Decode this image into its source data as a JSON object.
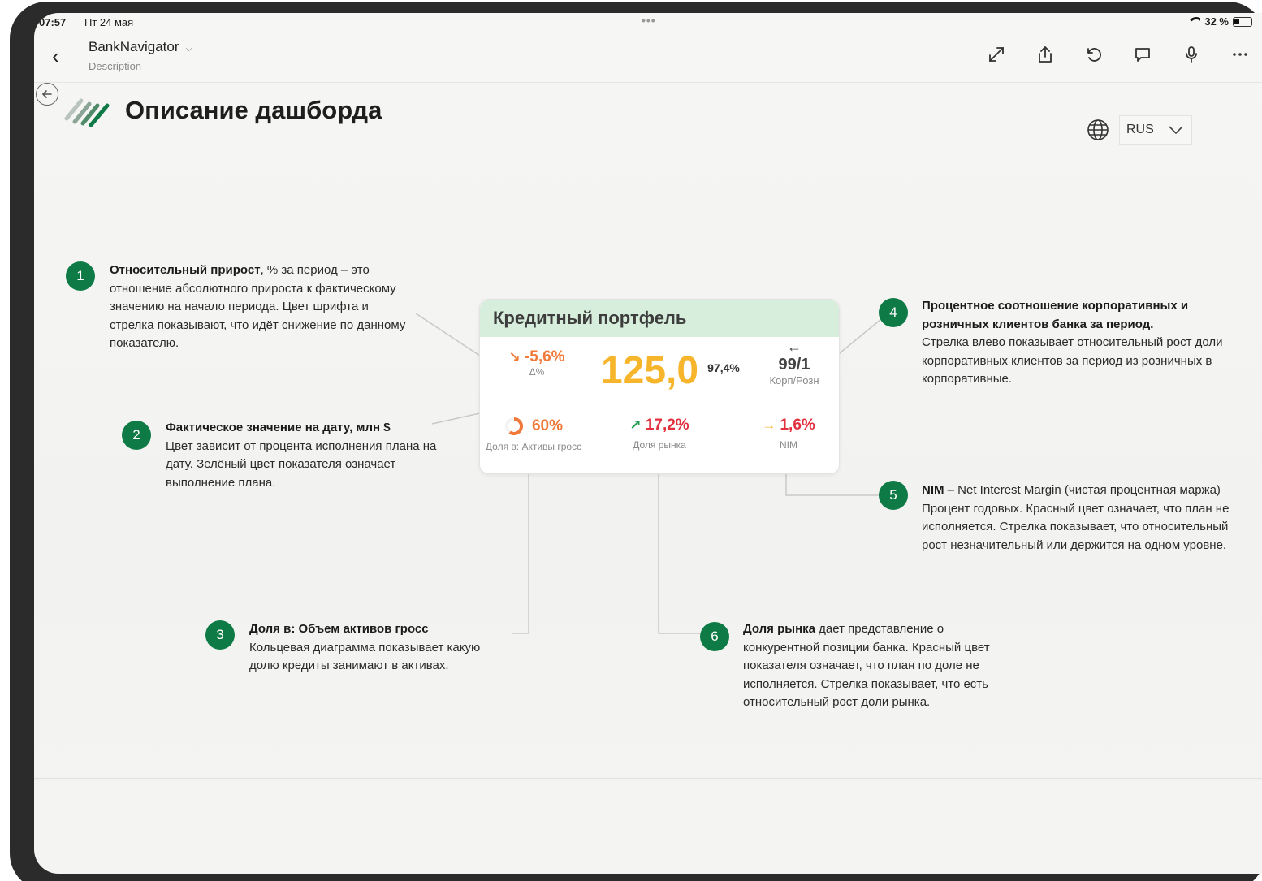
{
  "status_bar": {
    "time": "07:57",
    "date": "Пт 24 мая",
    "battery": "32 %"
  },
  "nav": {
    "app_name": "BankNavigator",
    "subtitle": "Description"
  },
  "page": {
    "title": "Описание дашборда"
  },
  "language": {
    "selected": "RUS"
  },
  "card": {
    "title": "Кредитный портфель",
    "delta": {
      "value": "-5,6%",
      "label": "Δ%"
    },
    "main_value": "125,0",
    "plan_pct": "97,4%",
    "corp_retail": {
      "value": "99/1",
      "label": "Корп/Розн"
    },
    "assets_share": {
      "value": "60%",
      "label": "Доля в: Активы гросс",
      "donut_fraction": 0.6
    },
    "market_share": {
      "value": "17,2%",
      "label": "Доля рынка"
    },
    "nim": {
      "value": "1,6%",
      "label": "NIM"
    }
  },
  "callouts": [
    {
      "num": "1",
      "bold": "Относительный прирост",
      "text": ", % за период – это отношение абсолютного прироста к фактическому значению на начало периода. Цвет шрифта и стрелка показывают, что идёт снижение по данному показателю."
    },
    {
      "num": "2",
      "bold": "Фактическое значение на дату, млн $",
      "text": "Цвет зависит от процента исполнения плана на дату. Зелёный цвет показателя означает выполнение плана."
    },
    {
      "num": "3",
      "bold": "Доля в: Объем активов гросс",
      "text": "Кольцевая диаграмма показывает какую долю кредиты занимают в активах."
    },
    {
      "num": "4",
      "bold": "Процентное соотношение корпоративных и розничных клиентов банка за период.",
      "text": "Стрелка влево показывает относительный рост доли корпоративных клиентов за период из розничных в корпоративные."
    },
    {
      "num": "5",
      "bold": "NIM",
      "text": " – Net Interest Margin (чистая процентная маржа) Процент годовых. Красный цвет означает, что план не исполняется. Стрелка показывает, что относительный рост незначительный или держится на одном уровне."
    },
    {
      "num": "6",
      "bold": "Доля рынка",
      "text": " дает представление о конкурентной позиции банка. Красный цвет показателя означает, что план по доле не исполняется. Стрелка показывает, что есть относительный рост доли рынка."
    }
  ],
  "colors": {
    "accent_green": "#0e7a45",
    "orange": "#f07a3a",
    "yellow": "#f7b52c",
    "red": "#e2303f",
    "green": "#1f9a4e",
    "card_header": "#d6eedb"
  }
}
